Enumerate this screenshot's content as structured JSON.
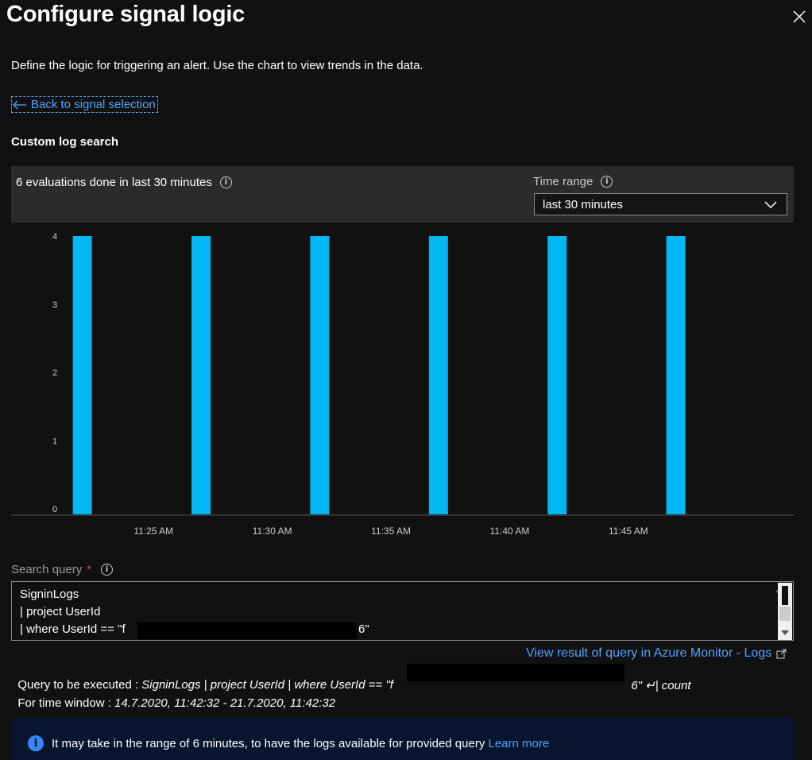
{
  "header": {
    "title": "Configure signal logic",
    "close_label": "Close"
  },
  "description": "Define the logic for triggering an alert. Use the chart to view trends in the data.",
  "back_link": "Back to signal selection",
  "section_title": "Custom log search",
  "evaluations_text": "6 evaluations done in last 30 minutes",
  "time_range": {
    "label": "Time range",
    "value": "last 30 minutes"
  },
  "chart_data": {
    "type": "bar",
    "x": [
      "11:22",
      "11:27",
      "11:32",
      "11:37",
      "11:42",
      "11:47"
    ],
    "values": [
      4,
      4,
      4,
      4,
      4,
      4
    ],
    "xticks": [
      "11:25 AM",
      "11:30 AM",
      "11:35 AM",
      "11:40 AM",
      "11:45 AM"
    ],
    "yticks": [
      "0",
      "1",
      "2",
      "3",
      "4"
    ],
    "ylim": [
      0,
      4
    ],
    "xrange": [
      "11:19",
      "11:52"
    ],
    "grid": false,
    "color": "#00b7f1"
  },
  "search_query": {
    "label": "Search query",
    "required_mark": "*",
    "lines": [
      "SigninLogs",
      "| project UserId",
      "| where UserId == \"f",
      "6\""
    ]
  },
  "view_result_link": "View result of query in Azure Monitor - Logs",
  "query_exec": {
    "prefix": "Query to be executed : ",
    "query_start": "SigninLogs | project UserId | where UserId == \"f",
    "query_end": "6\" ↵| count"
  },
  "time_window": {
    "prefix": "For time window : ",
    "value": "14.7.2020, 11:42:32 - 21.7.2020, 11:42:32"
  },
  "info_bar": {
    "text": "It may take in the range of 6 minutes, to have the logs available for provided query",
    "link": "Learn more"
  },
  "colors": {
    "accent": "#4da3ff",
    "bar": "#00b7f1",
    "background": "#111111",
    "info_bg": "#07152e"
  }
}
